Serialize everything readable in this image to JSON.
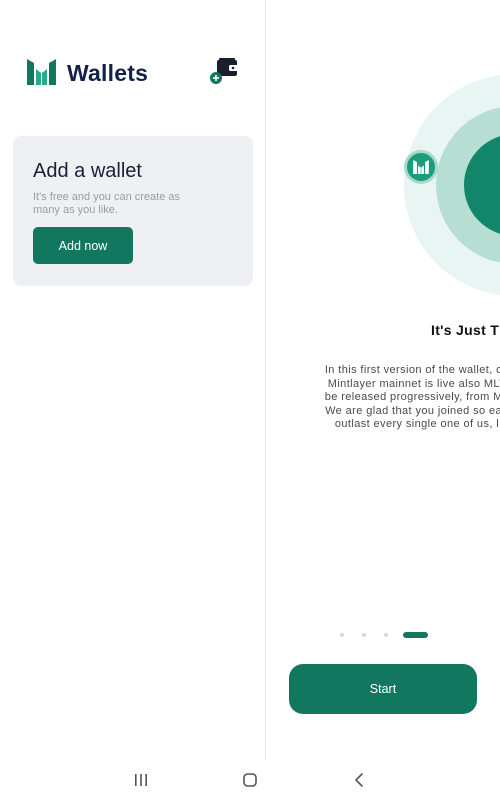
{
  "status_bar": {
    "icon": "notification-app-icon"
  },
  "sidebar": {
    "title": "Wallets",
    "logo_icon": "mintlayer-logo",
    "add_wallet_icon": "wallet-add-icon"
  },
  "add_card": {
    "title": "Add a wallet",
    "description": "It's free and you can create as many as you like.",
    "button_label": "Add now"
  },
  "onboarding": {
    "title": "It's Just T",
    "body_lines": [
      "In this first version of the wallet, on",
      "Mintlayer mainnet is live also MLT",
      "be released progressively, from ML",
      "We are glad that you joined so earl",
      "outlast every single one of us, l"
    ],
    "pager": {
      "total": 4,
      "active_index": 3
    },
    "start_label": "Start"
  },
  "nav_bar": {
    "items": [
      "recent-apps-icon",
      "home-icon",
      "back-icon"
    ]
  },
  "colors": {
    "accent": "#12775f",
    "title": "#13204a",
    "card_bg": "#eff0f3",
    "ring_outer": "#e9f5f2",
    "ring_mid": "#b7ded3",
    "ring_inner": "#12866a"
  }
}
